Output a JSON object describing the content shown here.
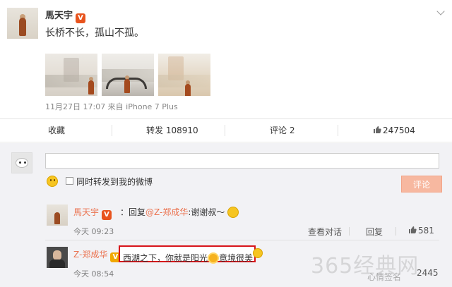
{
  "post": {
    "author": "馬天宇",
    "verified_badge": "V",
    "text": "长桥不长，孤山不孤。",
    "meta": "11月27日 17:07 来自 iPhone 7 Plus"
  },
  "actions": {
    "collect": "收藏",
    "repost": "转发 108910",
    "comment": "评论 2",
    "like": "247504"
  },
  "compose": {
    "placeholder": "",
    "repost_checkbox_label": "同时转发到我的微博",
    "submit_label": "评论"
  },
  "comments": [
    {
      "name": "馬天宇",
      "badge": "V",
      "prefix": "：回复",
      "mention": "@Z-郑成华",
      "text": ":谢谢叔～",
      "time": "今天 09:23",
      "view_convo": "查看对话",
      "reply": "回复",
      "likes": "581"
    },
    {
      "name": "Z-郑成华",
      "badge": "V",
      "text_before": "西湖之下，你就是阳光",
      "text_after": "意境很美",
      "time": "今天 08:54",
      "likes": "2445"
    }
  ],
  "watermark": {
    "main": "365经典网",
    "sub": "心情签名"
  },
  "icons": [
    "chevron-down-icon",
    "thumb-up-icon",
    "smiley-icon",
    "sun-emoji-icon",
    "checkbox-icon"
  ]
}
